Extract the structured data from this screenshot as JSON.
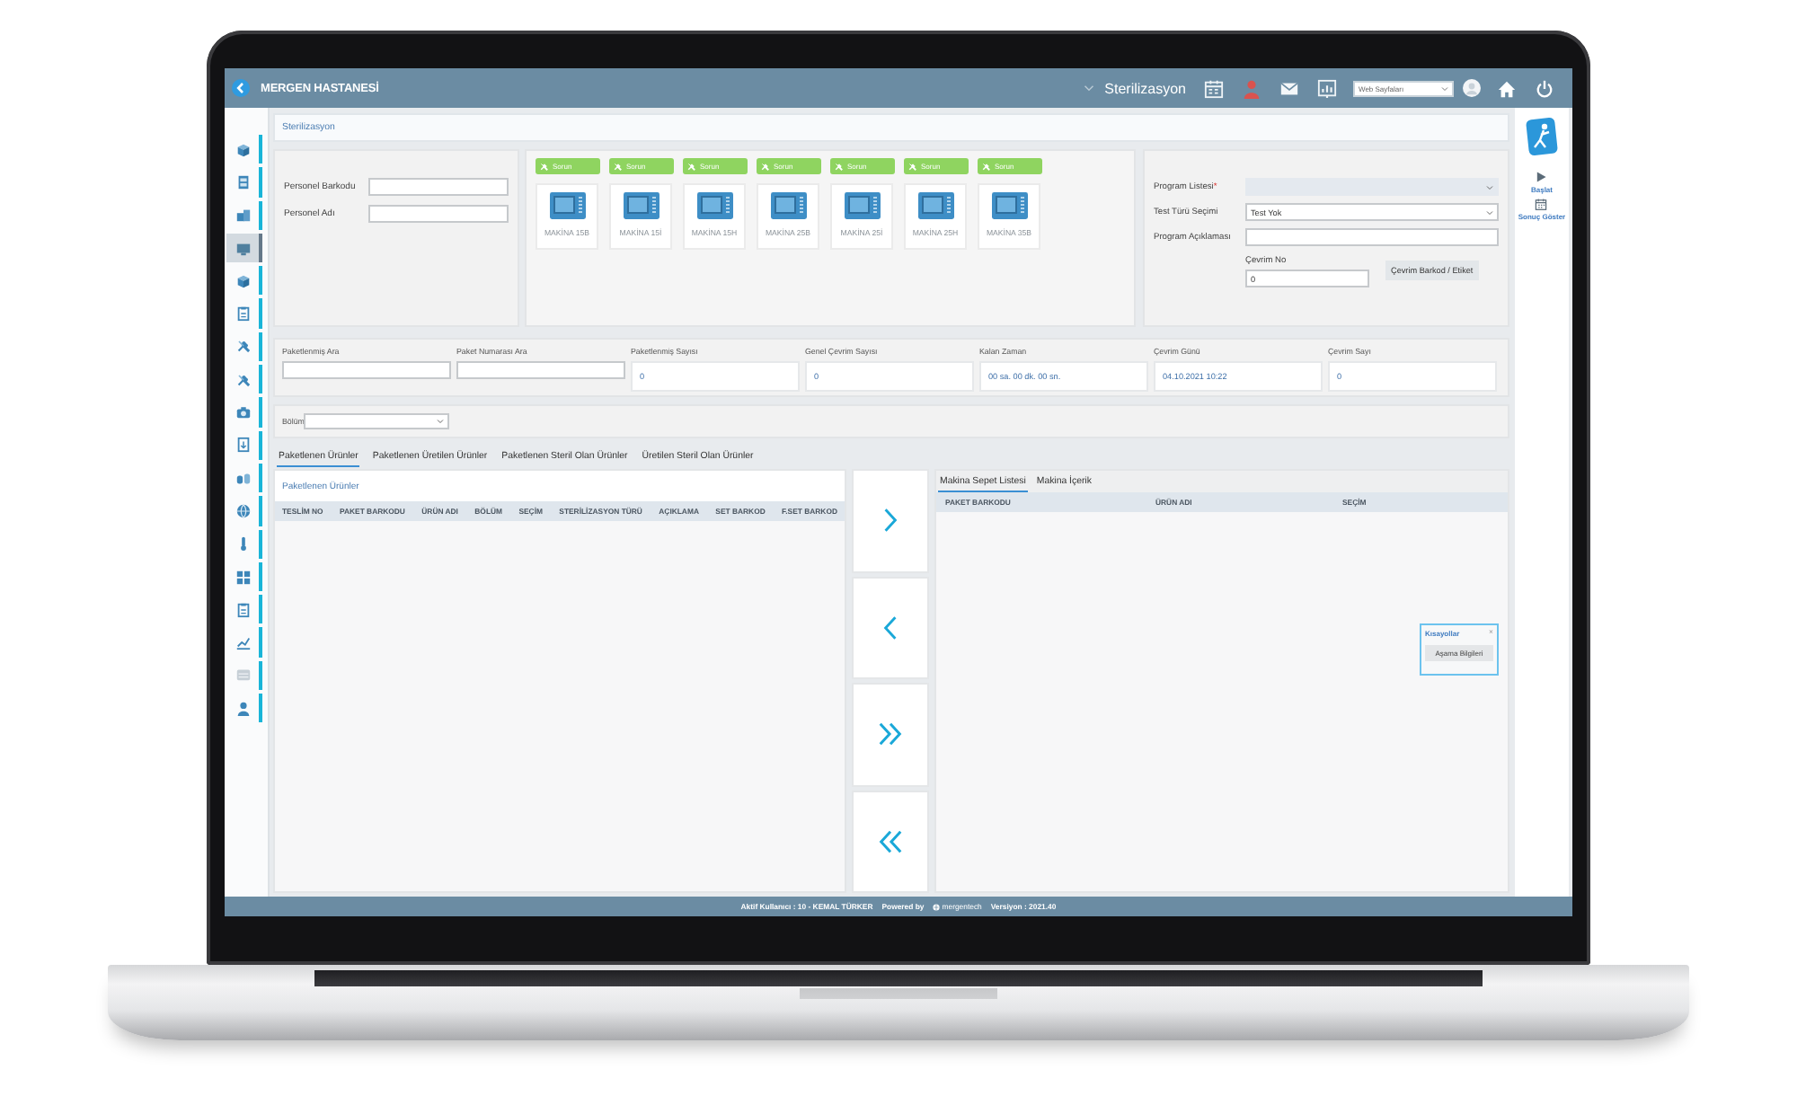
{
  "top_bar": {
    "hospital": "MERGEN HASTANESİ",
    "module": "Sterilizasyon",
    "web_pages_select": {
      "value": "Web Sayfaları"
    }
  },
  "sidebar": {
    "items": [
      {
        "selected": false
      },
      {
        "selected": false
      },
      {
        "selected": false
      },
      {
        "selected": true
      },
      {
        "selected": false
      },
      {
        "selected": false
      },
      {
        "selected": false
      },
      {
        "selected": false
      },
      {
        "selected": false
      },
      {
        "selected": false
      },
      {
        "selected": false
      },
      {
        "selected": false
      },
      {
        "selected": false
      },
      {
        "selected": false
      },
      {
        "selected": false
      },
      {
        "selected": false
      },
      {
        "selected": false
      },
      {
        "selected": false
      }
    ]
  },
  "breadcrumb": "Sterilizasyon",
  "personnel": [
    {
      "label": "Personel Barkodu"
    },
    {
      "label": "Personel Adı"
    }
  ],
  "machines": [
    {
      "status": "Sorun",
      "name": "MAKİNA 15B"
    },
    {
      "status": "Sorun",
      "name": "MAKİNA 15İ"
    },
    {
      "status": "Sorun",
      "name": "MAKİNA 15H"
    },
    {
      "status": "Sorun",
      "name": "MAKİNA 25B"
    },
    {
      "status": "Sorun",
      "name": "MAKİNA 25İ"
    },
    {
      "status": "Sorun",
      "name": "MAKİNA 25H"
    },
    {
      "status": "Sorun",
      "name": "MAKİNA 35B"
    }
  ],
  "program": {
    "fields": [
      {
        "label": "Program Listesi",
        "required_mark": "*",
        "kind": "select"
      },
      {
        "label": "Test Türü Seçimi",
        "kind": "select",
        "value": "Test Yok"
      },
      {
        "label": "Program Açıklaması",
        "kind": "text"
      }
    ],
    "cycle_no": {
      "label": "Çevrim No",
      "value": "0"
    },
    "barcode_button": "Çevrim Barkod / Etiket"
  },
  "summary": [
    {
      "label": "Paketlenmiş Ara",
      "kind": "input"
    },
    {
      "label": "Paket Numarası Ara",
      "kind": "input"
    },
    {
      "label": "Paketlenmiş Sayısı",
      "kind": "readout",
      "value": "0"
    },
    {
      "label": "Genel Çevrim Sayısı",
      "kind": "readout",
      "value": "0"
    },
    {
      "label": "Kalan Zaman",
      "kind": "readout",
      "value": "00 sa. 00 dk. 00 sn."
    },
    {
      "label": "Çevrim Günü",
      "kind": "readout",
      "value": "04.10.2021 10:22"
    },
    {
      "label": "Çevrim Sayı",
      "kind": "readout",
      "value": "0"
    }
  ],
  "department": {
    "label": "Bölüm"
  },
  "tabs": [
    {
      "label": "Paketlenen Ürünler",
      "selected": true
    },
    {
      "label": "Paketlenen Üretilen Ürünler",
      "selected": false
    },
    {
      "label": "Paketlenen Steril Olan Ürünler",
      "selected": false
    },
    {
      "label": "Üretilen Steril Olan Ürünler",
      "selected": false
    }
  ],
  "packaged_table": {
    "title": "Paketlenen Ürünler",
    "columns": [
      "TESLİM NO",
      "PAKET BARKODU",
      "ÜRÜN ADI",
      "BÖLÜM",
      "SEÇİM",
      "STERİLİZASYON TÜRÜ",
      "AÇIKLAMA",
      "SET BARKOD",
      "F.SET BARKOD"
    ]
  },
  "basket": {
    "tabs": [
      {
        "label": "Makina Sepet Listesi",
        "selected": true
      },
      {
        "label": "Makina İçerik",
        "selected": false
      }
    ],
    "columns": [
      "PAKET BARKODU",
      "ÜRÜN ADI",
      "SEÇİM"
    ]
  },
  "shortcuts": {
    "title": "Kısayollar",
    "close": "×",
    "button": "Aşama Bilgileri"
  },
  "right_rail": {
    "actions": [
      "Başlat",
      "Sonuç Göster"
    ]
  },
  "footer": {
    "user": "Aktif Kullanıcı : 10 - KEMAL TÜRKER",
    "powered_by": "Powered by",
    "brand": "mergentech",
    "version": "Versiyon : 2021.40"
  }
}
